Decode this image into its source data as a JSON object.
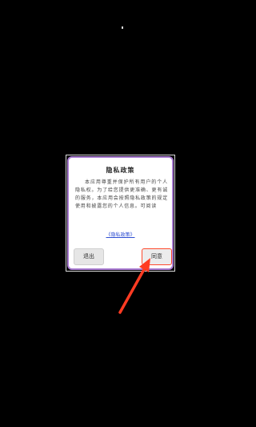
{
  "dialog": {
    "title": "隐私政策",
    "body": "本应用尊重并保护所有用户的个人隐私权。为了给您提供更准确、更有诚的服务，本应用会按照隐私政策的规定使用和披露您的个人信息。可阅读",
    "link": "《隐私政策》",
    "exit_label": "退出",
    "agree_label": "同意"
  },
  "colors": {
    "background": "#000000",
    "dialog_border": "#a97bd2",
    "link": "#2f4fd2",
    "highlight_arrow": "#ff3b22"
  },
  "icons": {
    "pointer": "red-arrow-icon"
  }
}
